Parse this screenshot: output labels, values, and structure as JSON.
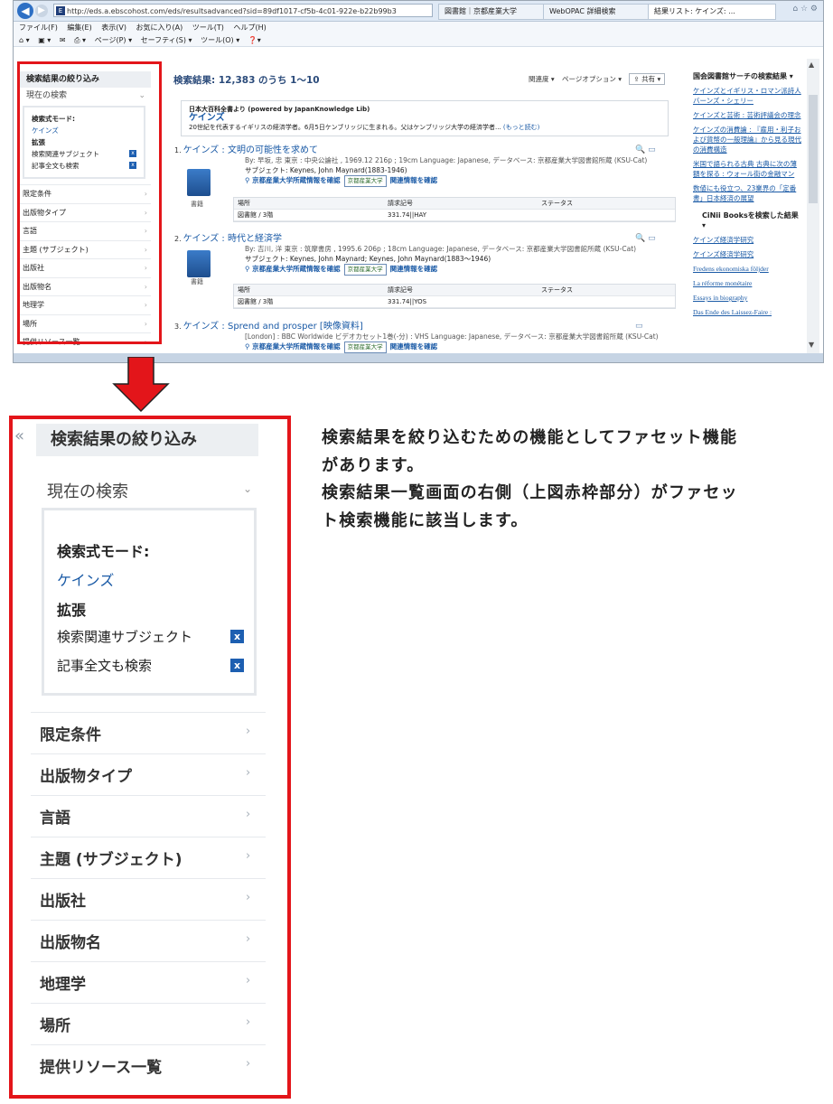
{
  "browser": {
    "address": "http://eds.a.ebscohost.com/eds/resultsadvanced?sid=89df1017-cf5b-4c01-922e-b22b99b3",
    "site_icon": "E",
    "tabs": [
      "図書館｜京都産業大学",
      "WebOPAC 詳細検索",
      "結果リスト: ケインズ: ..."
    ],
    "menu": [
      "ファイル(F)",
      "編集(E)",
      "表示(V)",
      "お気に入り(A)",
      "ツール(T)",
      "ヘルプ(H)"
    ],
    "commands": [
      "ページ(P) ▾",
      "セーフティ(S) ▾",
      "ツール(O) ▾"
    ]
  },
  "facet": {
    "collapse": "«",
    "title": "検索結果の絞り込み",
    "current_search": "現在の検索",
    "mode_label": "検索式モード:",
    "query": "ケインズ",
    "expand_label": "拡張",
    "expanders": [
      "検索関連サブジェクト",
      "記事全文も検索"
    ],
    "remove_icon": "x",
    "categories": [
      "限定条件",
      "出版物タイプ",
      "言語",
      "主題 (サブジェクト)",
      "出版社",
      "出版物名",
      "地理学",
      "場所",
      "提供リソース一覧"
    ]
  },
  "results": {
    "header": "検索結果: 12,383 のうち 1～10",
    "relevance": "関連度 ▾",
    "page_options": "ページオプション ▾",
    "share": "共有 ▾",
    "encyclopedia": {
      "source": "日本大百科全書より (powered by JapanKnowledge Lib)",
      "title": "ケインズ",
      "snippet": "20世紀を代表するイギリスの経済学者。6月5日ケンブリッジに生まれる。父はケンブリッジ大学の経済学者... ",
      "more": "(もっと読む)"
    },
    "records": [
      {
        "num": "1.",
        "title": "ケインズ : 文明の可能性を求めて",
        "meta": "By: 早坂, 忠 東京 : 中央公論社 , 1969.12 216p ; 19cm Language: Japanese, データベース: 京都産業大学図書館所蔵 (KSU-Cat)",
        "subject": "サブジェクト: Keynes, John Maynard(1883-1946)",
        "link1": "京都産業大学所蔵情報を確認",
        "link2": "関連情報を確認",
        "type": "書籍",
        "holdings": {
          "headers": [
            "場所",
            "請求記号",
            "ステータス"
          ],
          "row": [
            "図書館 / 3階",
            "331.74||HAY",
            ""
          ]
        }
      },
      {
        "num": "2.",
        "title": "ケインズ : 時代と経済学",
        "meta": "By: 吉川, 洋 東京 : 筑摩書房 , 1995.6 206p ; 18cm Language: Japanese, データベース: 京都産業大学図書館所蔵 (KSU-Cat)",
        "subject": "サブジェクト: Keynes, John Maynard; Keynes, John Maynard(1883～1946)",
        "link1": "京都産業大学所蔵情報を確認",
        "link2": "関連情報を確認",
        "type": "書籍",
        "holdings": {
          "headers": [
            "場所",
            "請求記号",
            "ステータス"
          ],
          "row": [
            "図書館 / 3階",
            "331.74||YOS",
            ""
          ]
        }
      },
      {
        "num": "3.",
        "title": "ケインズ : Sprend and prosper [映像資料]",
        "meta": "[London] : BBC Worldwide ビデオカセット1巻(-分) : VHS Language: Japanese, データベース: 京都産業大学図書館所蔵 (KSU-Cat)",
        "link1": "京都産業大学所蔵情報を確認",
        "link2": "関連情報を確認"
      }
    ]
  },
  "sidebar": {
    "ndl_title": "国会図書館サーチの検索結果 ▾",
    "ndl_links": [
      "ケインズとイギリス・ロマン派詩人バーンズ・シェリー",
      "ケインズと芸術 : 芸術評議会の理念",
      "ケインズの消費論 : 『雇用・利子および貨幣の一般理論』から見る現代の消費構造",
      "米国で語られる古典 古典に次の薄額を探る : ウォール街の金融マン",
      "数値にも役立つ、23業界の「定番書」日本経済の展望"
    ],
    "cinii_title": "CiNii Booksを検索した結果 ▾",
    "cinii_links": [
      "ケインズ経済学研究",
      "ケインズ経済学研究",
      "Fredens ekonomiska följder",
      "La réforme monétaire",
      "Essays in biography",
      "Das Ende des Laissez-Faire :"
    ]
  },
  "description": {
    "line1": "検索結果を絞り込むための機能としてファセット機能",
    "line2": "があります。",
    "line3": "検索結果一覧画面の右側（上図赤枠部分）がファセッ",
    "line4": "ト検索機能に該当します。"
  },
  "colors": {
    "highlight": "#e3151a",
    "link": "#1a5aa6",
    "remove_badge": "#1d5fb1"
  }
}
